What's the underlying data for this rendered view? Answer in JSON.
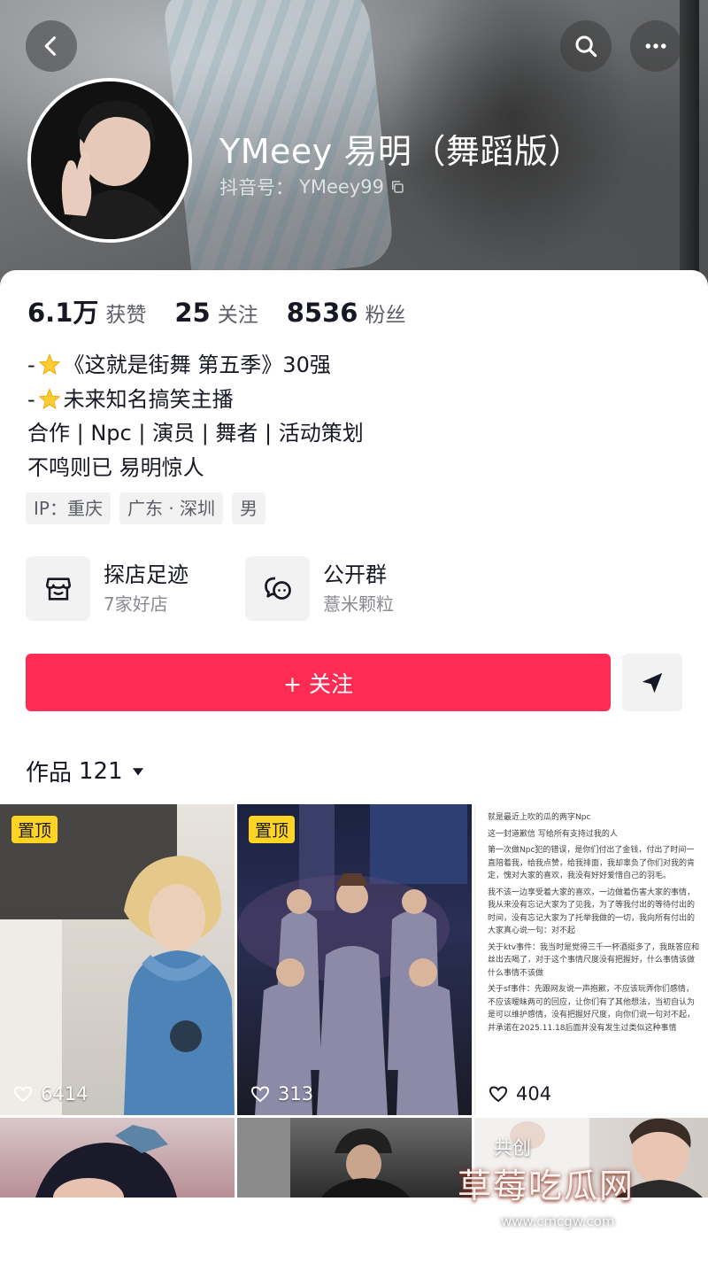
{
  "header": {
    "display_name": "YMeey 易明（舞蹈版）",
    "account_label": "抖音号：",
    "account_id": "YMeey99"
  },
  "stats": [
    {
      "value": "6.1万",
      "label": "获赞"
    },
    {
      "value": "25",
      "label": "关注"
    },
    {
      "value": "8536",
      "label": "粉丝"
    }
  ],
  "bio": {
    "line1_prefix": "-",
    "line1_text": "《这就是街舞 第五季》30强",
    "line2_prefix": "-",
    "line2_text": "未来知名搞笑主播",
    "line3": "合作 | Npc | 演员 | 舞者 | 活动策划",
    "line4": "不鸣则已 易明惊人"
  },
  "tags": [
    "IP：重庆",
    "广东 · 深圳",
    "男"
  ],
  "features": [
    {
      "title": "探店足迹",
      "subtitle": "7家好店",
      "icon": "store-icon"
    },
    {
      "title": "公开群",
      "subtitle": "薏米颗粒",
      "icon": "group-chat-icon"
    }
  ],
  "actions": {
    "follow_label": "+ 关注"
  },
  "works": {
    "label": "作品",
    "count": "121"
  },
  "grid": [
    {
      "pinned": "置顶",
      "likes": "6414"
    },
    {
      "pinned": "置顶",
      "likes": "313"
    },
    {
      "likes": "404",
      "doc_lines": [
        "就是最近上吹的瓜的两字Npc",
        "这一封道歉信 写给所有支持过我的人",
        "第一次做Npc犯的错误，是你们付出了金钱，付出了时间一直陪着我，给我点赞，给我排面，我却辜负了你们对我的肯定，愧对大家的喜欢，我没有好好爱惜自己的羽毛。",
        "我不该一边享受着大家的喜欢，一边做着伤害大家的事情，我从来没有忘记大家为了见我，为了等我付出的等待付出的时间，没有忘记大家为了托举我做的一切，我向所有付出的大家真心说一句：对不起",
        "关于ktv事件：我当时是觉得三千一杯酒挺多了，我既答应和丝出去喝了，对于这个事情尺度没有把握好，什么事情该做什么事情不该做",
        "关于sf事件：先跟网友说一声抱歉，不应该玩弄你们感情，不应该暧昧两可的回应，让你们有了其他想法，当初自认为是可以维护感情，没有把握好尺度，向你们说一句对不起，并承诺在2025.11.18后面并没有发生过类似这种事情"
      ]
    },
    {},
    {},
    {
      "cochuang": "共创"
    }
  ],
  "watermark": {
    "text": "草莓吃瓜网",
    "url": "www.cmcgw.com"
  },
  "colors": {
    "accent": "#fe2c55",
    "pin_badge": "#ffd422",
    "text_primary": "#161823",
    "text_secondary": "#5b5e66"
  }
}
